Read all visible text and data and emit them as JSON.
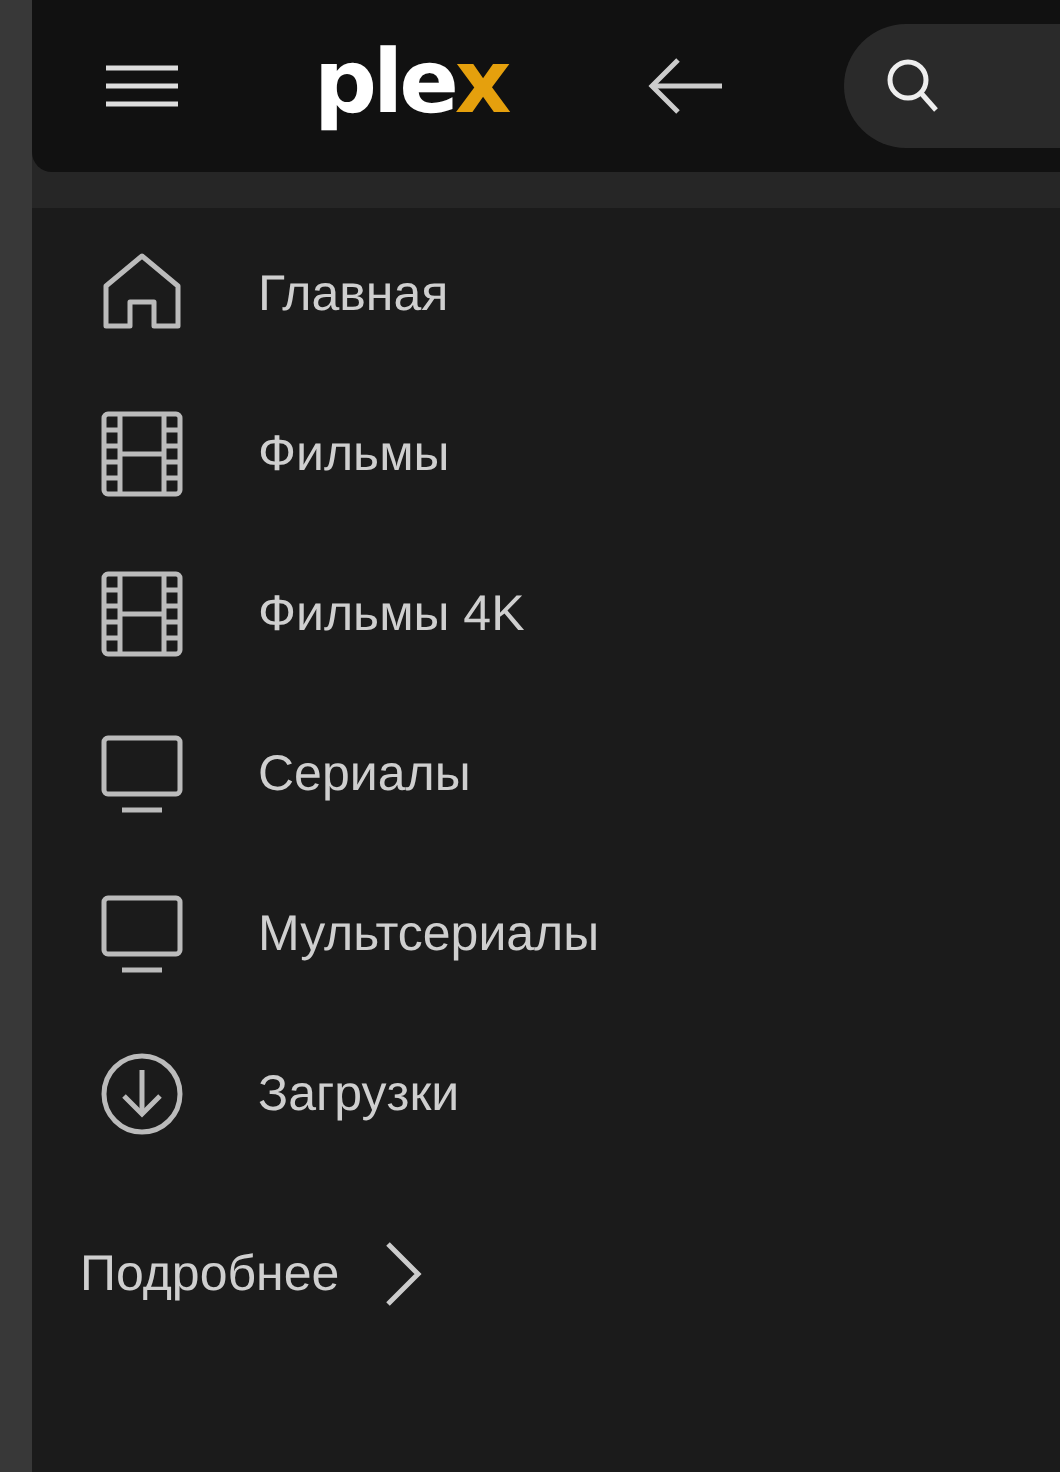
{
  "top_bar": {
    "logo": {
      "text": "ple",
      "accent": "x"
    }
  },
  "sidebar": {
    "items": [
      {
        "kind": "home",
        "label": "Главная"
      },
      {
        "kind": "film",
        "label": "Фильмы"
      },
      {
        "kind": "film",
        "label": "Фильмы 4K"
      },
      {
        "kind": "tv",
        "label": "Сериалы"
      },
      {
        "kind": "tv",
        "label": "Мультсериалы"
      },
      {
        "kind": "download",
        "label": "Загрузки"
      }
    ],
    "more": {
      "label": "Подробнее"
    }
  }
}
